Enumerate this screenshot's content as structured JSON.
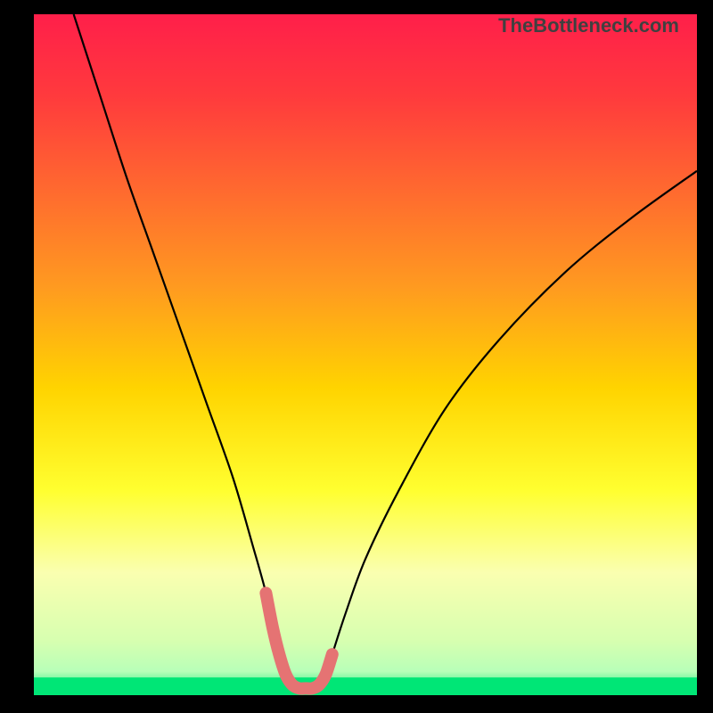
{
  "watermark": "TheBottleneck.com",
  "chart_data": {
    "type": "line",
    "title": "",
    "xlabel": "",
    "ylabel": "",
    "xlim": [
      0,
      100
    ],
    "ylim": [
      0,
      100
    ],
    "series": [
      {
        "name": "bottleneck-curve",
        "x": [
          6,
          10,
          14,
          18,
          22,
          26,
          30,
          33,
          35,
          36,
          37,
          38,
          39,
          40,
          41,
          42,
          43,
          44,
          45,
          47,
          50,
          55,
          62,
          70,
          80,
          90,
          100
        ],
        "y": [
          100,
          88,
          76,
          65,
          54,
          43,
          32,
          22,
          15,
          10,
          6,
          3,
          1.5,
          1,
          1,
          1,
          1.5,
          3,
          6,
          12,
          20,
          30,
          42,
          52,
          62,
          70,
          77
        ]
      }
    ],
    "valid_band": {
      "start": 35,
      "end": 45,
      "color": "#e57373"
    },
    "green_base": {
      "y": 0,
      "height": 2.6
    },
    "gradient_stops": [
      {
        "offset": 0.0,
        "color": "#ff1f4a"
      },
      {
        "offset": 0.12,
        "color": "#ff3a3d"
      },
      {
        "offset": 0.26,
        "color": "#ff6a2f"
      },
      {
        "offset": 0.4,
        "color": "#ff9a20"
      },
      {
        "offset": 0.55,
        "color": "#ffd400"
      },
      {
        "offset": 0.7,
        "color": "#ffff30"
      },
      {
        "offset": 0.82,
        "color": "#faffb0"
      },
      {
        "offset": 0.92,
        "color": "#d7ffb0"
      },
      {
        "offset": 0.965,
        "color": "#b8ffb8"
      },
      {
        "offset": 1.0,
        "color": "#00e676"
      }
    ]
  }
}
